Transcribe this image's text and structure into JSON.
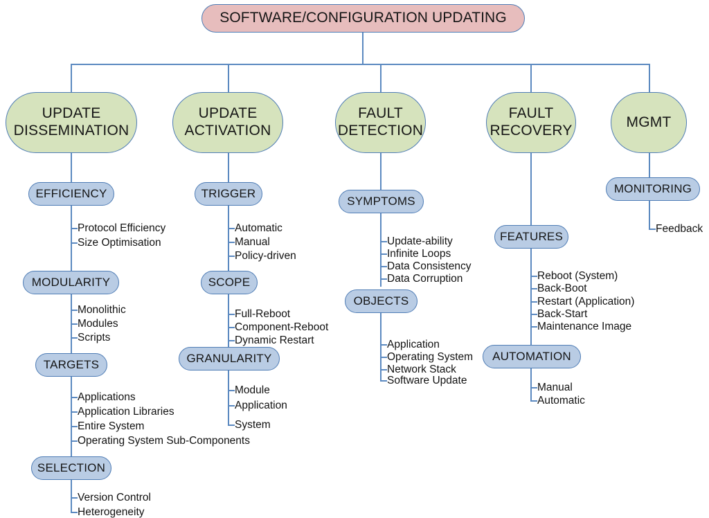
{
  "diagram": {
    "title": "Software/Configuration Updating taxonomy tree",
    "colors": {
      "root_fill": "#E7BDBD",
      "category_fill": "#D6E3BD",
      "subnode_fill": "#B9CCE4",
      "line": "#5B89C0",
      "border": "#4E7CB5",
      "text": "#151515",
      "background": "#FFFFFF"
    },
    "root": {
      "label": "SOFTWARE/CONFIGURATION UPDATING"
    },
    "branches": [
      {
        "id": "update-dissemination",
        "label": "UPDATE\nDISSEMINATION",
        "subnodes": [
          {
            "id": "efficiency",
            "label": "EFFICIENCY",
            "leaves": [
              "Protocol Efficiency",
              "Size Optimisation"
            ]
          },
          {
            "id": "modularity",
            "label": "MODULARITY",
            "leaves": [
              "Monolithic",
              "Modules",
              "Scripts"
            ]
          },
          {
            "id": "targets",
            "label": "TARGETS",
            "leaves": [
              "Applications",
              "Application Libraries",
              "Entire System",
              "Operating System Sub-Components"
            ]
          },
          {
            "id": "selection",
            "label": "SELECTION",
            "leaves": [
              "Version Control",
              "Heterogeneity"
            ]
          }
        ]
      },
      {
        "id": "update-activation",
        "label": "UPDATE\nACTIVATION",
        "subnodes": [
          {
            "id": "trigger",
            "label": "TRIGGER",
            "leaves": [
              "Automatic",
              "Manual",
              "Policy-driven"
            ]
          },
          {
            "id": "scope",
            "label": "SCOPE",
            "leaves": [
              "Full-Reboot",
              "Component-Reboot",
              "Dynamic Restart"
            ]
          },
          {
            "id": "granularity",
            "label": "GRANULARITY",
            "leaves": [
              "Module",
              "Application",
              "System"
            ]
          }
        ]
      },
      {
        "id": "fault-detection",
        "label": "FAULT\nDETECTION",
        "subnodes": [
          {
            "id": "symptoms",
            "label": "SYMPTOMS",
            "leaves": [
              "Update-ability",
              "Infinite Loops",
              "Data Consistency",
              "Data Corruption"
            ]
          },
          {
            "id": "objects",
            "label": "OBJECTS",
            "leaves": [
              "Application",
              "Operating System",
              "Network Stack",
              "Software Update"
            ]
          }
        ]
      },
      {
        "id": "fault-recovery",
        "label": "FAULT\nRECOVERY",
        "subnodes": [
          {
            "id": "features",
            "label": "FEATURES",
            "leaves": [
              "Reboot (System)",
              "Back-Boot",
              "Restart (Application)",
              "Back-Start",
              "Maintenance Image"
            ]
          },
          {
            "id": "automation",
            "label": "AUTOMATION",
            "leaves": [
              "Manual",
              "Automatic"
            ]
          }
        ]
      },
      {
        "id": "mgmt",
        "label": "MGMT",
        "subnodes": [
          {
            "id": "monitoring",
            "label": "MONITORING",
            "leaves": [
              "Feedback"
            ]
          }
        ]
      }
    ]
  }
}
